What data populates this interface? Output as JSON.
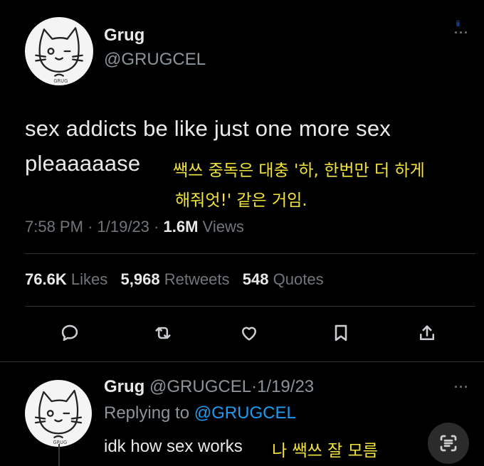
{
  "top_mark": "ii",
  "tweet": {
    "author_name": "Grug",
    "author_handle": "@GRUGCEL",
    "text_line1": "sex addicts be like just one more sex",
    "text_line2": "pleaaaaase",
    "ko_line1": "쌕쓰 중독은 대충 '하, 한번만 더 하게",
    "ko_line2": "해줘엇!' 같은 거임.",
    "time": "7:58 PM",
    "sep1": "·",
    "date": "1/19/23",
    "sep2": "·",
    "views_count": "1.6M",
    "views_label": "Views",
    "stats": {
      "likes_count": "76.6K",
      "likes_label": "Likes",
      "retweets_count": "5,968",
      "retweets_label": "Retweets",
      "quotes_count": "548",
      "quotes_label": "Quotes"
    },
    "actions": [
      "reply-icon",
      "retweet-icon",
      "like-icon",
      "bookmark-icon",
      "share-icon"
    ]
  },
  "reply": {
    "author_name": "Grug",
    "author_handle": "@GRUGCEL",
    "sep": "·",
    "date": "1/19/23",
    "replying_prefix": "Replying to",
    "replying_handle": "@GRUGCEL",
    "text": "idk how sex works",
    "ko_text": "나 쌕쓰 잘 모름"
  },
  "colors": {
    "background": "#000000",
    "text": "#e7e9ea",
    "muted": "#71767b",
    "link": "#1d9bf0",
    "korean_overlay": "#f2e33a"
  }
}
